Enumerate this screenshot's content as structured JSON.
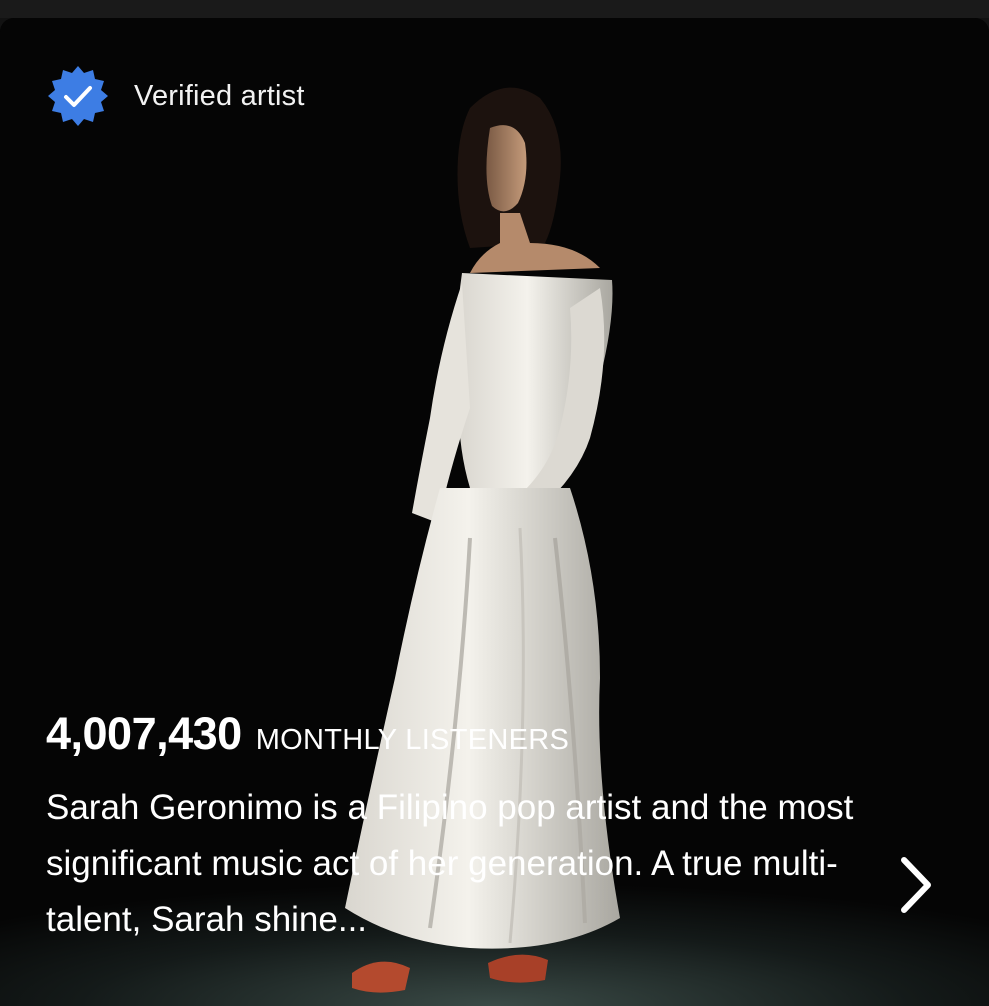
{
  "artist_card": {
    "verified_label": "Verified artist",
    "monthly_listeners_count": "4,007,430",
    "monthly_listeners_label": "MONTHLY LISTENERS",
    "bio": "Sarah Geronimo is a Filipino pop artist and the most significant music act of her generation. A true multi-talent, Sarah shine..."
  },
  "icons": {
    "badge": "verified-badge-icon",
    "next": "chevron-right-icon"
  },
  "colors": {
    "verified_badge": "#3d7de4",
    "background": "#050505",
    "text": "#ffffff"
  }
}
